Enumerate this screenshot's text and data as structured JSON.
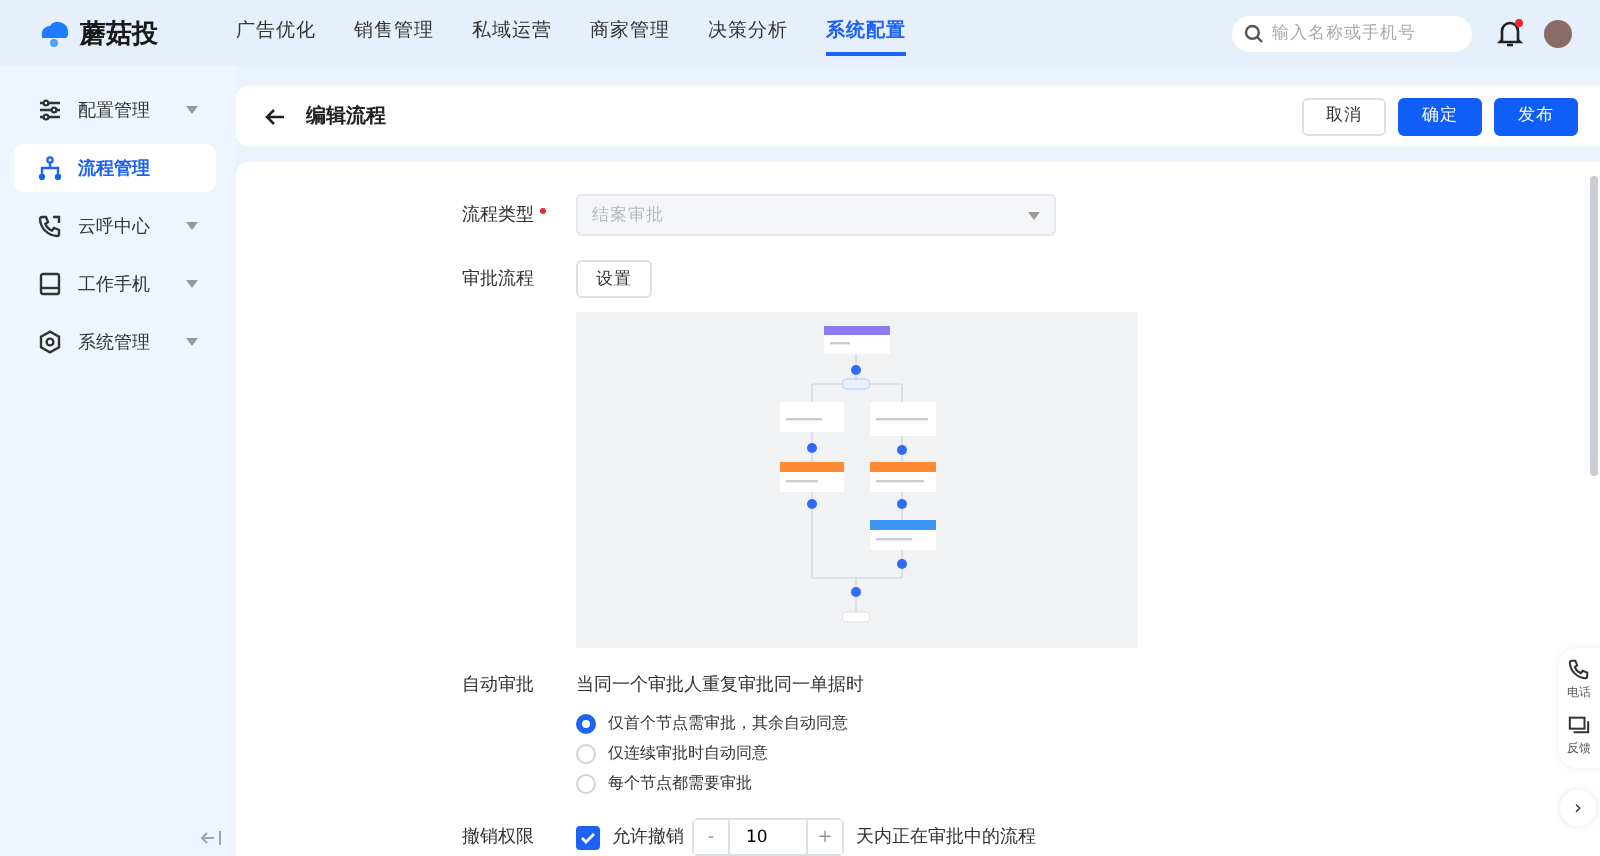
{
  "app": {
    "logo": "蘑菇投"
  },
  "nav": [
    {
      "label": "广告优化",
      "selected": false
    },
    {
      "label": "销售管理",
      "selected": false
    },
    {
      "label": "私域运营",
      "selected": false
    },
    {
      "label": "商家管理",
      "selected": false
    },
    {
      "label": "决策分析",
      "selected": false
    },
    {
      "label": "系统配置",
      "selected": true
    }
  ],
  "search": {
    "placeholder": "输入名称或手机号"
  },
  "notifications": {
    "unread": true
  },
  "sidebar": {
    "items": [
      {
        "label": "配置管理",
        "kind": "sliders",
        "selected": false,
        "expandable": true
      },
      {
        "label": "流程管理",
        "kind": "flow",
        "selected": true,
        "expandable": false
      },
      {
        "label": "云呼中心",
        "kind": "phone",
        "selected": false,
        "expandable": true
      },
      {
        "label": "工作手机",
        "kind": "device",
        "selected": false,
        "expandable": true
      },
      {
        "label": "系统管理",
        "kind": "gear",
        "selected": false,
        "expandable": true
      }
    ]
  },
  "header": {
    "title": "编辑流程",
    "buttons": [
      {
        "label": "取消",
        "kind": "default"
      },
      {
        "label": "确定",
        "kind": "primary"
      },
      {
        "label": "发布",
        "kind": "primary"
      }
    ]
  },
  "form": {
    "flow_type": {
      "label": "流程类型",
      "required": true,
      "value": "结案审批",
      "disabled": true
    },
    "approval_flow": {
      "label": "审批流程",
      "button": "设置"
    },
    "auto_approval": {
      "label": "自动审批",
      "description": "当同一个审批人重复审批同一单据时",
      "options": [
        {
          "label": "仅首个节点需审批，其余自动同意",
          "selected": true
        },
        {
          "label": "仅连续审批时自动同意",
          "selected": false
        },
        {
          "label": "每个节点都需要审批",
          "selected": false
        }
      ]
    },
    "revoke": {
      "label": "撤销权限",
      "checkbox": {
        "label": "允许撤销",
        "checked": true
      },
      "stepper": {
        "minus": "-",
        "value": "10",
        "plus": "+"
      },
      "suffix": "天内正在审批中的流程"
    }
  },
  "float_panel": {
    "items": [
      {
        "label": "电话",
        "kind": "phone"
      },
      {
        "label": "反馈",
        "kind": "feedback"
      }
    ],
    "next": "›"
  }
}
